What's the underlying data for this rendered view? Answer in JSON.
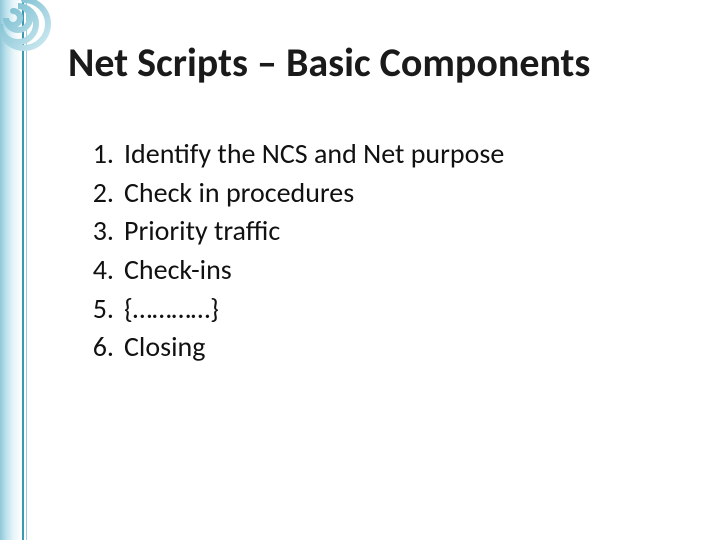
{
  "title": "Net Scripts – Basic Components",
  "items": [
    {
      "num": "1.",
      "text": "Identify the NCS and Net purpose"
    },
    {
      "num": "2.",
      "text": "Check in procedures"
    },
    {
      "num": "3.",
      "text": "Priority traffic"
    },
    {
      "num": "4.",
      "text": "Check-ins"
    },
    {
      "num": "5.",
      "text": "{…………}"
    },
    {
      "num": "6.",
      "text": "Closing"
    }
  ]
}
